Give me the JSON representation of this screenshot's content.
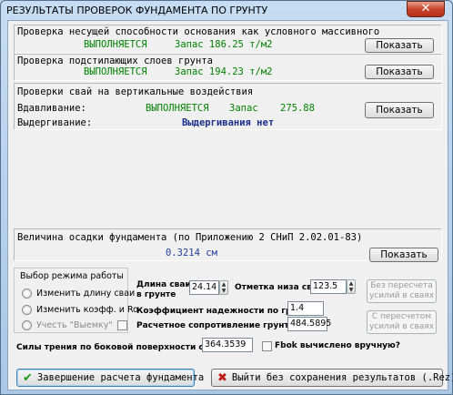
{
  "window": {
    "title": "РЕЗУЛЬТАТЫ ПРОВЕРОК ФУНДАМЕНТА ПО ГРУНТУ",
    "close": "✕"
  },
  "check1": {
    "title": "Проверка несущей способности основания как условного массивного",
    "status": "ВЫПОЛНЯЕТСЯ",
    "reserve": "Запас 186.25 т/м2",
    "button": "Показать"
  },
  "check2": {
    "title": "Проверка подстилающих слоев грунта",
    "status": "ВЫПОЛНЯЕТСЯ",
    "reserve": "Запас 194.23 т/м2",
    "button": "Показать"
  },
  "piles": {
    "title": "Проверки свай на вертикальные воздействия",
    "press_label": "Вдавливание:",
    "press_status": "ВЫПОЛНЯЕТСЯ",
    "press_reserve_label": "Запас",
    "press_reserve_value": "275.88",
    "pull_label": "Выдергивание:",
    "pull_status": "Выдергивания нет",
    "button": "Показать"
  },
  "settlement": {
    "title": "Величина осадки фундамента (по Приложению 2 СНиП 2.02.01-83)",
    "value": "0.3214 см",
    "button": "Показать"
  },
  "mode": {
    "title": "Выбор режима работы",
    "options": [
      "Изменить длину сваи",
      "Изменить коэфф. и Ro",
      "Учесть \"Выемку\""
    ]
  },
  "params": {
    "pile_length_label_1": "Длина сваи",
    "pile_length_label_2": "в грунте",
    "pile_length": "24.14",
    "pile_bottom_label": "Отметка низа свай",
    "pile_bottom": "123.5",
    "reliability_label": "Коэффициент надежности по грунту",
    "reliability": "1.4",
    "resistance_label": "Расчетное сопротивление грунта R",
    "resistance": "484.5895",
    "friction_label": "Силы трения по боковой поверхности сваи [т]",
    "friction": "364.3539",
    "fbok_label": "Fbok вычислено вручную?"
  },
  "side_buttons": {
    "no_recalc_1": "Без пересчета",
    "no_recalc_2": "усилий в сваях",
    "recalc_1": "С пересчетом",
    "recalc_2": "усилий в сваях"
  },
  "footer": {
    "finish": "Завершение расчета фундамента",
    "exit": "Выйти без сохранения результатов (.Rez)"
  }
}
